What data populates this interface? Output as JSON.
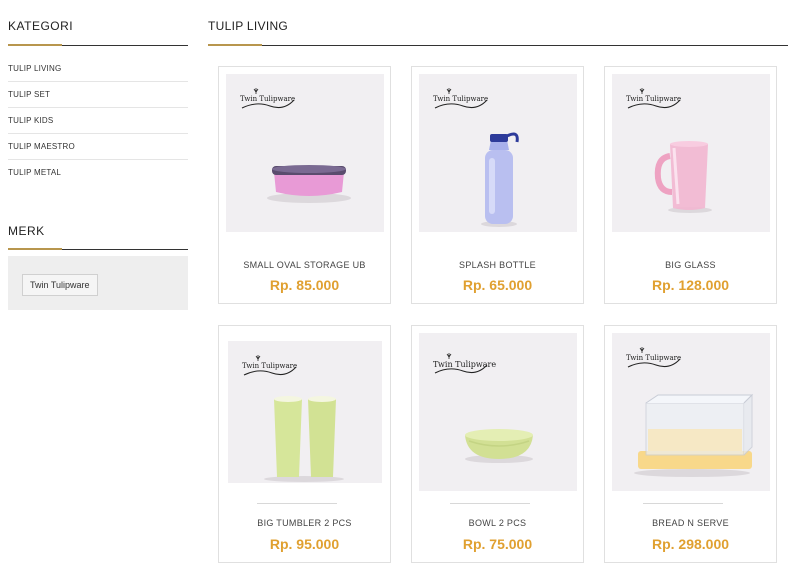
{
  "sidebar": {
    "category_heading": "KATEGORI",
    "categories": [
      {
        "label": "TULIP LIVING"
      },
      {
        "label": "TULIP SET"
      },
      {
        "label": "TULIP KIDS"
      },
      {
        "label": "TULIP MAESTRO"
      },
      {
        "label": "TULIP METAL"
      }
    ],
    "brand_heading": "MERK",
    "brands": [
      {
        "label": "Twin Tulipware"
      }
    ]
  },
  "main": {
    "heading": "TULIP LIVING",
    "products": [
      {
        "name": "SMALL OVAL STORAGE UB",
        "price": "Rp. 85.000",
        "logo": "Twin Tulipware",
        "icon": "oval-storage-icon"
      },
      {
        "name": "SPLASH BOTTLE",
        "price": "Rp. 65.000",
        "logo": "Twin Tulipware",
        "icon": "bottle-icon"
      },
      {
        "name": "BIG GLASS",
        "price": "Rp. 128.000",
        "logo": "Twin Tulipware",
        "icon": "glass-icon"
      },
      {
        "name": "BIG TUMBLER 2 PCS",
        "price": "Rp. 95.000",
        "logo": "Twin Tulipware",
        "icon": "tumbler-icon"
      },
      {
        "name": "BOWL 2 PCS",
        "price": "Rp. 75.000",
        "logo": "Twin Tulipware",
        "icon": "bowl-icon"
      },
      {
        "name": "BREAD N SERVE",
        "price": "Rp. 298.000",
        "logo": "Twin Tulipware",
        "icon": "bread-box-icon"
      }
    ]
  },
  "colors": {
    "accent": "#b8964e",
    "price": "#e0a030",
    "photo_bg": "#f1eff2"
  }
}
